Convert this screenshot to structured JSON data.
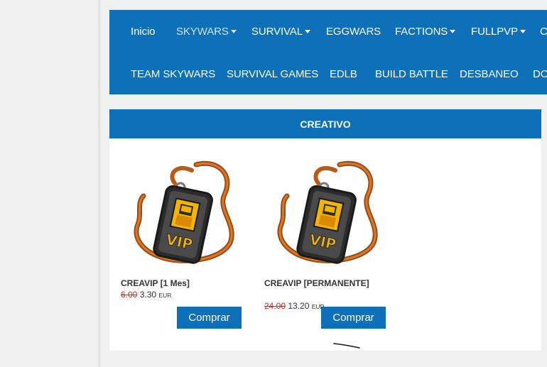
{
  "nav": {
    "row1": [
      {
        "label": "Inicio",
        "dropdown": false
      },
      {
        "label": "SKYWARS",
        "dropdown": true
      },
      {
        "label": "SURVIVAL",
        "dropdown": true
      },
      {
        "label": "EGGWARS",
        "dropdown": false
      },
      {
        "label": "FACTIONS",
        "dropdown": true
      },
      {
        "label": "FULLPVP",
        "dropdown": true
      },
      {
        "label": "C",
        "dropdown": false
      }
    ],
    "row2": [
      {
        "label": "TEAM SKYWARS"
      },
      {
        "label": "SURVIVAL GAMES"
      },
      {
        "label": "EDLB"
      },
      {
        "label": "BUILD BATTLE"
      },
      {
        "label": "DESBANEO"
      },
      {
        "label": "DO"
      }
    ]
  },
  "category": {
    "title": "CREATIVO",
    "products": [
      {
        "name": "CREAVIP [1 Mes]",
        "old_price": "6.00",
        "price": "3.30",
        "currency": "EUR",
        "button": "Comprar",
        "image_icon": "vip-tag-icon"
      },
      {
        "name": "CREAVIP [PERMANENTE]",
        "old_price": "24.00",
        "price": "13.20",
        "currency": "EUR",
        "button": "Comprar",
        "image_icon": "vip-tag-icon"
      }
    ]
  },
  "colors": {
    "brand": "#0d70b8",
    "old_price": "#d9261c"
  }
}
